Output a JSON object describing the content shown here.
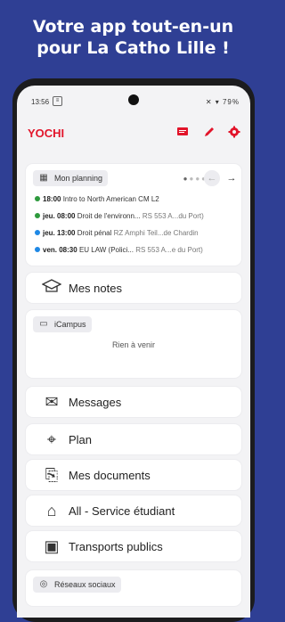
{
  "promo": {
    "line1": "Votre app tout-en-un",
    "line2": "pour La Catho Lille !"
  },
  "status": {
    "time": "13:56",
    "right": "✕ ▾ 79%"
  },
  "app": {
    "title": "YOCHI"
  },
  "planning": {
    "title": "Mon planning",
    "events": [
      {
        "day": "18:00",
        "name": "Intro to North American CM L2",
        "room": "",
        "color": "#2e9a3d"
      },
      {
        "day": "jeu. 08:00",
        "name": "Droit de l'environn...",
        "room": "RS 553 A...du Port)",
        "color": "#2e9a3d"
      },
      {
        "day": "jeu. 13:00",
        "name": "Droit pénal",
        "room": "RZ Amphi Teil...de Chardin",
        "color": "#1e88e5"
      },
      {
        "day": "ven. 08:30",
        "name": "EU LAW (Polici...",
        "room": "RS 553 A...e du Port)",
        "color": "#1e88e5"
      }
    ]
  },
  "notes": {
    "label": "Mes notes"
  },
  "icampus": {
    "title": "iCampus",
    "empty": "Rien à venir"
  },
  "menu": [
    {
      "label": "Messages",
      "icon": "messages-icon",
      "glyph": "✉"
    },
    {
      "label": "Plan",
      "icon": "map-icon",
      "glyph": "⌖"
    },
    {
      "label": "Mes documents",
      "icon": "document-icon",
      "glyph": "⎘"
    },
    {
      "label": "All - Service étudiant",
      "icon": "student-service-icon",
      "glyph": "⌂"
    },
    {
      "label": "Transports publics",
      "icon": "bus-icon",
      "glyph": "▣"
    }
  ],
  "social": {
    "label": "Réseaux sociaux"
  },
  "colors": {
    "background": "#2f3f94",
    "accent": "#e2142a"
  }
}
